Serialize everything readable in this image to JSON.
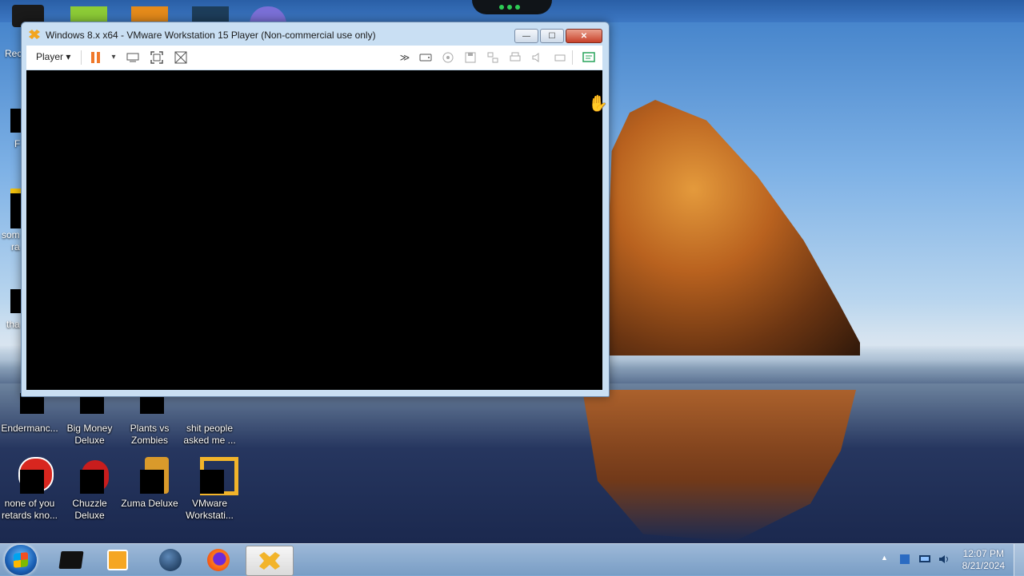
{
  "window": {
    "title": "Windows 8.x x64 - VMware Workstation 15 Player (Non-commercial use only)",
    "controls": {
      "minimize": "—",
      "maximize": "☐",
      "close": "✕"
    }
  },
  "toolbar": {
    "player_label": "Player",
    "player_caret": "▾",
    "more_label": "≫"
  },
  "desktop": {
    "partial_icons": [
      {
        "label": "Rec"
      },
      {
        "label": "F"
      },
      {
        "label": "som"
      },
      {
        "label": "ra"
      },
      {
        "label": "tha"
      }
    ],
    "icons": [
      {
        "label": "Endermanc..."
      },
      {
        "label": "Big Money Deluxe"
      },
      {
        "label": "Plants vs Zombies"
      },
      {
        "label": "shit people asked me ..."
      },
      {
        "label": "none of you retards kno..."
      },
      {
        "label": "Chuzzle Deluxe"
      },
      {
        "label": "Zuma Deluxe"
      },
      {
        "label": "VMware Workstati..."
      }
    ]
  },
  "taskbar": {
    "apps": [
      "terminal-app",
      "media-player-app",
      "globe-app",
      "firefox-app",
      "vmware-app"
    ],
    "tray_arrow": "▲",
    "time": "12:07 PM",
    "date": "8/21/2024"
  },
  "colors": {
    "accent": "#3d78c4",
    "vmware_orange": "#f39c12",
    "pause_orange": "#f0782a"
  }
}
